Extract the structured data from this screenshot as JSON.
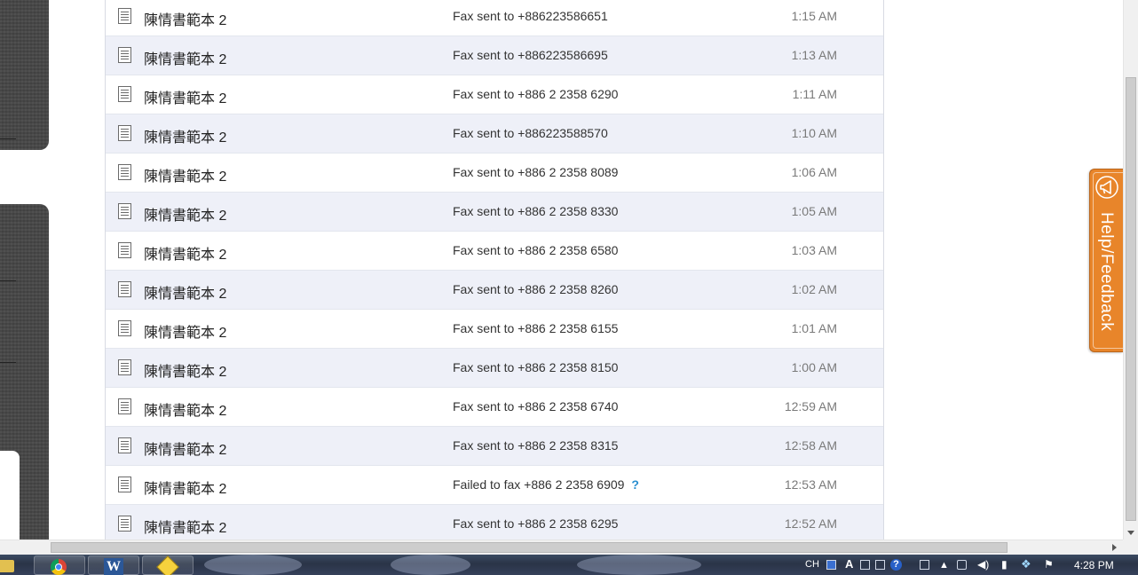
{
  "fax_list": {
    "rows": [
      {
        "name": "陳情書範本 2",
        "status": "Fax sent to +886223586651",
        "time": "1:15 AM"
      },
      {
        "name": "陳情書範本 2",
        "status": "Fax sent to +886223586695",
        "time": "1:13 AM"
      },
      {
        "name": "陳情書範本 2",
        "status": "Fax sent to +886 2 2358 6290",
        "time": "1:11 AM"
      },
      {
        "name": "陳情書範本 2",
        "status": "Fax sent to +886223588570",
        "time": "1:10 AM"
      },
      {
        "name": "陳情書範本 2",
        "status": "Fax sent to +886 2 2358 8089",
        "time": "1:06 AM"
      },
      {
        "name": "陳情書範本 2",
        "status": "Fax sent to +886 2 2358 8330",
        "time": "1:05 AM"
      },
      {
        "name": "陳情書範本 2",
        "status": "Fax sent to +886 2 2358 6580",
        "time": "1:03 AM"
      },
      {
        "name": "陳情書範本 2",
        "status": "Fax sent to +886 2 2358 8260",
        "time": "1:02 AM"
      },
      {
        "name": "陳情書範本 2",
        "status": "Fax sent to +886 2 2358 6155",
        "time": "1:01 AM"
      },
      {
        "name": "陳情書範本 2",
        "status": "Fax sent to +886 2 2358 8150",
        "time": "1:00 AM"
      },
      {
        "name": "陳情書範本 2",
        "status": "Fax sent to +886 2 2358 6740",
        "time": "12:59 AM"
      },
      {
        "name": "陳情書範本 2",
        "status": "Fax sent to +886 2 2358 8315",
        "time": "12:58 AM"
      },
      {
        "name": "陳情書範本 2",
        "status": "Failed to fax +886 2 2358 6909",
        "help": "?",
        "time": "12:53 AM"
      },
      {
        "name": "陳情書範本 2",
        "status": "Fax sent to +886 2 2358 6295",
        "time": "12:52 AM"
      }
    ]
  },
  "help_tab": {
    "label": "Help/Feedback",
    "icon": "megaphone-icon",
    "color": "#e8852a"
  },
  "taskbar": {
    "apps": [
      {
        "name": "folder",
        "icon": "folder-icon"
      },
      {
        "name": "chrome",
        "icon": "chrome-icon"
      },
      {
        "name": "word",
        "icon": "word-icon",
        "glyph": "W"
      },
      {
        "name": "notes",
        "icon": "sticky-note-icon"
      }
    ],
    "tray": {
      "language": "CH",
      "ime": "A",
      "help": "?"
    },
    "clock": "4:28 PM"
  },
  "colors": {
    "row_alt": "#eef0f8",
    "help_link": "#2a8fd0",
    "time_text": "#7a7a7a"
  }
}
